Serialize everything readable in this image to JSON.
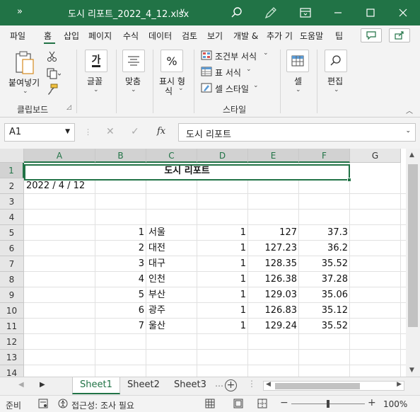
{
  "window": {
    "quick_access": "»",
    "title": "도시 리포트_2022_4_12.xlsx",
    "title_caret": "∨",
    "icons": [
      "search-icon",
      "pen-icon",
      "ribbon-display-icon",
      "minimize-icon",
      "maximize-icon",
      "close-icon"
    ],
    "accent": "#217346"
  },
  "ribbon_tabs": [
    "파일",
    "홈",
    "삽입",
    "페이지",
    "수식",
    "데이터",
    "검토",
    "보기",
    "개발 &",
    "추가 기",
    "도움말",
    "팁"
  ],
  "ribbon": {
    "clipboard": {
      "paste": "붙여넣기",
      "group": "클립보드"
    },
    "font": {
      "label": "글꼴",
      "glyph": "가"
    },
    "align": {
      "label": "맞춤"
    },
    "number": {
      "label1": "표시 형",
      "label2": "식",
      "glyph": "%"
    },
    "styles": {
      "cond": "조건부 서식",
      "table": "표 서식",
      "cell": "셀 스타일",
      "group": "스타일"
    },
    "cells": {
      "label": "셀"
    },
    "editing": {
      "label": "편집"
    }
  },
  "formula_bar": {
    "name_box": "A1",
    "fx": "fx",
    "formula": "도시 리포트"
  },
  "columns": [
    "A",
    "B",
    "C",
    "D",
    "E",
    "F",
    "G"
  ],
  "rows": [
    "1",
    "2",
    "3",
    "4",
    "5",
    "6",
    "7",
    "8",
    "9",
    "10",
    "11",
    "12",
    "13",
    "14"
  ],
  "cells": {
    "title": "도시 리포트",
    "date": "2022 / 4 / 12",
    "table": [
      {
        "no": "1",
        "city": "서울",
        "d": "1",
        "e": "127",
        "f": "37.3"
      },
      {
        "no": "2",
        "city": "대전",
        "d": "1",
        "e": "127.23",
        "f": "36.2"
      },
      {
        "no": "3",
        "city": "대구",
        "d": "1",
        "e": "128.35",
        "f": "35.52"
      },
      {
        "no": "4",
        "city": "인천",
        "d": "1",
        "e": "126.38",
        "f": "37.28"
      },
      {
        "no": "5",
        "city": "부산",
        "d": "1",
        "e": "129.03",
        "f": "35.06"
      },
      {
        "no": "6",
        "city": "광주",
        "d": "1",
        "e": "126.83",
        "f": "35.12"
      },
      {
        "no": "7",
        "city": "울산",
        "d": "1",
        "e": "129.24",
        "f": "35.52"
      }
    ]
  },
  "sheets": [
    "Sheet1",
    "Sheet2",
    "Sheet3"
  ],
  "status": {
    "mode": "준비",
    "accessibility": "접근성: 조사 필요",
    "zoom": "100%"
  }
}
